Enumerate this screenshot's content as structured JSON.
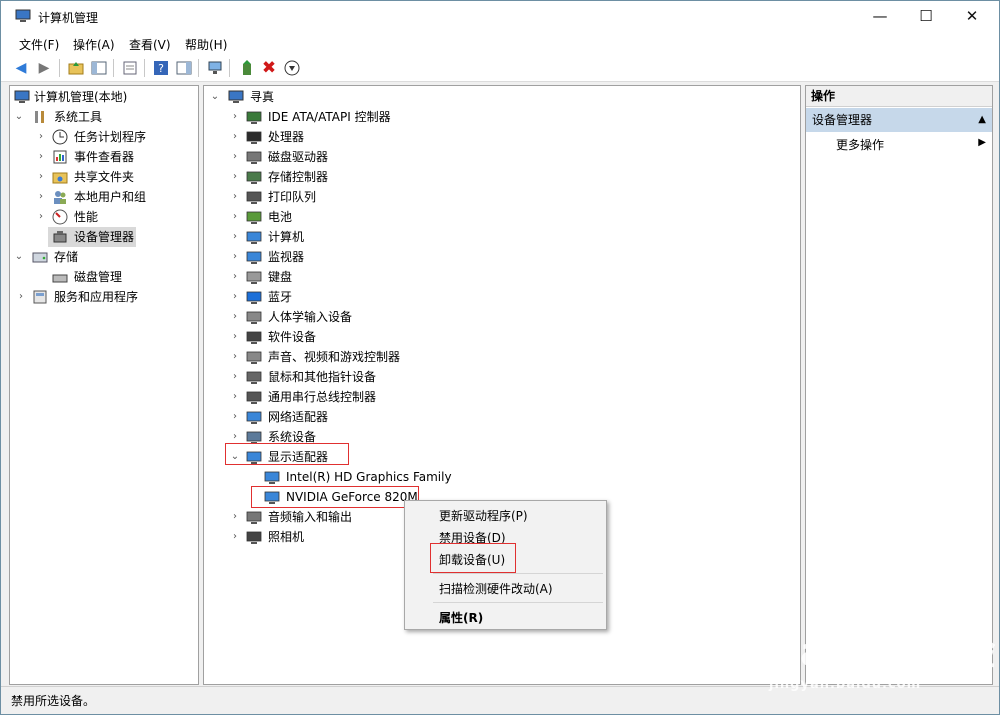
{
  "window": {
    "title": "计算机管理"
  },
  "window_controls": {
    "minimize": "—",
    "maximize": "☐",
    "close": "✕"
  },
  "menu": [
    "文件(F)",
    "操作(A)",
    "查看(V)",
    "帮助(H)"
  ],
  "left_tree": {
    "root": "计算机管理(本地)",
    "items": [
      {
        "label": "系统工具",
        "level": 1,
        "expanded": true
      },
      {
        "label": "任务计划程序",
        "level": 2
      },
      {
        "label": "事件查看器",
        "level": 2
      },
      {
        "label": "共享文件夹",
        "level": 2
      },
      {
        "label": "本地用户和组",
        "level": 2
      },
      {
        "label": "性能",
        "level": 2
      },
      {
        "label": "设备管理器",
        "level": 2,
        "selected": true
      },
      {
        "label": "存储",
        "level": 1,
        "expanded": true
      },
      {
        "label": "磁盘管理",
        "level": 2
      },
      {
        "label": "服务和应用程序",
        "level": 1
      }
    ]
  },
  "device_tree": {
    "root": "寻真",
    "categories": [
      "IDE ATA/ATAPI 控制器",
      "处理器",
      "磁盘驱动器",
      "存储控制器",
      "打印队列",
      "电池",
      "计算机",
      "监视器",
      "键盘",
      "蓝牙",
      "人体学输入设备",
      "软件设备",
      "声音、视频和游戏控制器",
      "鼠标和其他指针设备",
      "通用串行总线控制器",
      "网络适配器",
      "系统设备",
      "显示适配器"
    ],
    "display_children": [
      "Intel(R) HD Graphics Family",
      "NVIDIA GeForce 820M"
    ],
    "after_categories": [
      "音频输入和输出",
      "照相机"
    ]
  },
  "context_menu": {
    "items": [
      "更新驱动程序(P)",
      "禁用设备(D)",
      "卸载设备(U)",
      "扫描检测硬件改动(A)",
      "属性(R)"
    ]
  },
  "actions_pane": {
    "header": "操作",
    "selected": "设备管理器",
    "more": "更多操作"
  },
  "status_bar": {
    "text": "禁用所选设备。"
  },
  "watermark": {
    "brand": "Bai du 经验",
    "url": "jingyan.baidu.com"
  },
  "colors": {
    "highlight_box": "#e03030",
    "action_selected": "#c6d8ea"
  }
}
